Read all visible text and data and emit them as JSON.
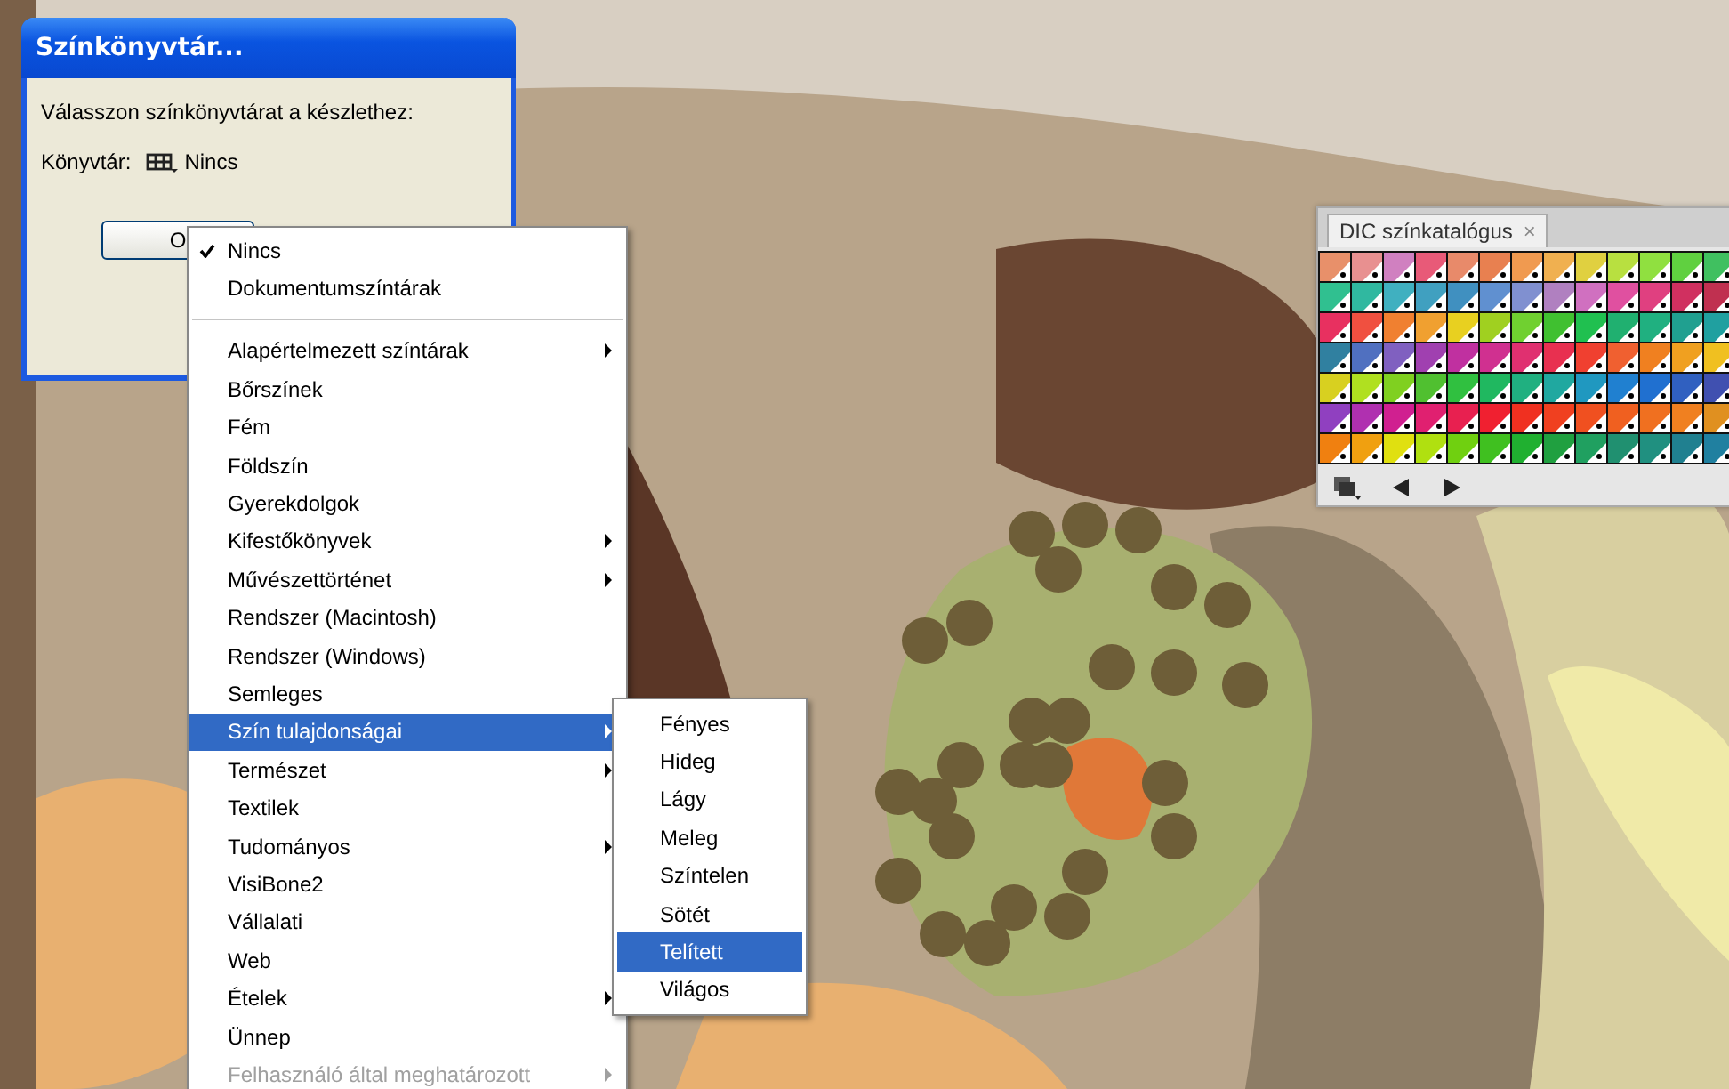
{
  "dialog": {
    "title": "Színkönyvtár...",
    "prompt": "Válasszon színkönyvtárat a készlethez:",
    "library_label": "Könyvtár:",
    "library_value": "Nincs",
    "ok_button": "O"
  },
  "menu": {
    "items": [
      {
        "label": "Nincs",
        "kind": "item",
        "checked": true,
        "submenu": false,
        "selected": false,
        "disabled": false
      },
      {
        "label": "Dokumentumszíntárak",
        "kind": "item",
        "checked": false,
        "submenu": false,
        "selected": false,
        "disabled": false
      },
      {
        "kind": "separator"
      },
      {
        "label": "Alapértelmezett színtárak",
        "kind": "item",
        "checked": false,
        "submenu": true,
        "selected": false,
        "disabled": false
      },
      {
        "label": "Bőrszínek",
        "kind": "item",
        "checked": false,
        "submenu": false,
        "selected": false,
        "disabled": false
      },
      {
        "label": "Fém",
        "kind": "item",
        "checked": false,
        "submenu": false,
        "selected": false,
        "disabled": false
      },
      {
        "label": "Földszín",
        "kind": "item",
        "checked": false,
        "submenu": false,
        "selected": false,
        "disabled": false
      },
      {
        "label": "Gyerekdolgok",
        "kind": "item",
        "checked": false,
        "submenu": false,
        "selected": false,
        "disabled": false
      },
      {
        "label": "Kifestőkönyvek",
        "kind": "item",
        "checked": false,
        "submenu": true,
        "selected": false,
        "disabled": false
      },
      {
        "label": "Művészettörténet",
        "kind": "item",
        "checked": false,
        "submenu": true,
        "selected": false,
        "disabled": false
      },
      {
        "label": "Rendszer (Macintosh)",
        "kind": "item",
        "checked": false,
        "submenu": false,
        "selected": false,
        "disabled": false
      },
      {
        "label": "Rendszer (Windows)",
        "kind": "item",
        "checked": false,
        "submenu": false,
        "selected": false,
        "disabled": false
      },
      {
        "label": "Semleges",
        "kind": "item",
        "checked": false,
        "submenu": false,
        "selected": false,
        "disabled": false
      },
      {
        "label": "Szín tulajdonságai",
        "kind": "item",
        "checked": false,
        "submenu": true,
        "selected": true,
        "disabled": false
      },
      {
        "label": "Természet",
        "kind": "item",
        "checked": false,
        "submenu": true,
        "selected": false,
        "disabled": false
      },
      {
        "label": "Textilek",
        "kind": "item",
        "checked": false,
        "submenu": false,
        "selected": false,
        "disabled": false
      },
      {
        "label": "Tudományos",
        "kind": "item",
        "checked": false,
        "submenu": true,
        "selected": false,
        "disabled": false
      },
      {
        "label": "VisiBone2",
        "kind": "item",
        "checked": false,
        "submenu": false,
        "selected": false,
        "disabled": false
      },
      {
        "label": "Vállalati",
        "kind": "item",
        "checked": false,
        "submenu": false,
        "selected": false,
        "disabled": false
      },
      {
        "label": "Web",
        "kind": "item",
        "checked": false,
        "submenu": false,
        "selected": false,
        "disabled": false
      },
      {
        "label": "Ételek",
        "kind": "item",
        "checked": false,
        "submenu": true,
        "selected": false,
        "disabled": false
      },
      {
        "label": "Ünnep",
        "kind": "item",
        "checked": false,
        "submenu": false,
        "selected": false,
        "disabled": false
      },
      {
        "label": "Felhasználó által meghatározott",
        "kind": "item",
        "checked": false,
        "submenu": true,
        "selected": false,
        "disabled": true
      }
    ]
  },
  "submenu": {
    "items": [
      {
        "label": "Fényes",
        "selected": false
      },
      {
        "label": "Hideg",
        "selected": false
      },
      {
        "label": "Lágy",
        "selected": false
      },
      {
        "label": "Meleg",
        "selected": false
      },
      {
        "label": "Színtelen",
        "selected": false
      },
      {
        "label": "Sötét",
        "selected": false
      },
      {
        "label": "Telített",
        "selected": true
      },
      {
        "label": "Világos",
        "selected": false
      }
    ]
  },
  "swatch_panel": {
    "tab": "DIC színkatalógus",
    "close": "×",
    "swatches": [
      {
        "color": "#e8906a"
      },
      {
        "color": "#e89090"
      },
      {
        "color": "#d080c0"
      },
      {
        "color": "#e85a78"
      },
      {
        "color": "#e88a6a"
      },
      {
        "color": "#e88050"
      },
      {
        "color": "#f09a50"
      },
      {
        "color": "#f0b050"
      },
      {
        "color": "#e0d040"
      },
      {
        "color": "#b8e040"
      },
      {
        "color": "#90e040"
      },
      {
        "color": "#60d040"
      },
      {
        "color": "#40c060"
      },
      {
        "color": "#30c090"
      },
      {
        "color": "#30b8a0"
      },
      {
        "color": "#40b0c0"
      },
      {
        "color": "#40a0c0"
      },
      {
        "color": "#4090c0"
      },
      {
        "color": "#6090d0"
      },
      {
        "color": "#8090d0"
      },
      {
        "color": "#b080c0"
      },
      {
        "color": "#d070c0"
      },
      {
        "color": "#e050a0"
      },
      {
        "color": "#e04080"
      },
      {
        "color": "#d03060"
      },
      {
        "color": "#c03050"
      },
      {
        "color": "#e83060"
      },
      {
        "color": "#f05040"
      },
      {
        "color": "#f08030"
      },
      {
        "color": "#f0a030"
      },
      {
        "color": "#e8d020"
      },
      {
        "color": "#a0d020"
      },
      {
        "color": "#70d030"
      },
      {
        "color": "#40c030"
      },
      {
        "color": "#20c050"
      },
      {
        "color": "#20b070"
      },
      {
        "color": "#20b080"
      },
      {
        "color": "#20a090"
      },
      {
        "color": "#20a0a0"
      },
      {
        "color": "#3080a0"
      },
      {
        "color": "#5070c0"
      },
      {
        "color": "#8060c0"
      },
      {
        "color": "#a040b0"
      },
      {
        "color": "#c030a0"
      },
      {
        "color": "#d03090"
      },
      {
        "color": "#e03070"
      },
      {
        "color": "#e83050"
      },
      {
        "color": "#f04030"
      },
      {
        "color": "#f06030"
      },
      {
        "color": "#f08020"
      },
      {
        "color": "#f0a020"
      },
      {
        "color": "#f0c020"
      },
      {
        "color": "#d8d020"
      },
      {
        "color": "#b0e020"
      },
      {
        "color": "#80d020"
      },
      {
        "color": "#50c030"
      },
      {
        "color": "#30c040"
      },
      {
        "color": "#20b860"
      },
      {
        "color": "#20b080"
      },
      {
        "color": "#20a8a0"
      },
      {
        "color": "#2098c0"
      },
      {
        "color": "#2080d0"
      },
      {
        "color": "#2070d0"
      },
      {
        "color": "#3060c0"
      },
      {
        "color": "#4050b0"
      },
      {
        "color": "#9040c0"
      },
      {
        "color": "#b030b0"
      },
      {
        "color": "#d02090"
      },
      {
        "color": "#e02070"
      },
      {
        "color": "#e82050"
      },
      {
        "color": "#f02030"
      },
      {
        "color": "#f03020"
      },
      {
        "color": "#f04020"
      },
      {
        "color": "#f05020"
      },
      {
        "color": "#f06020"
      },
      {
        "color": "#f07020"
      },
      {
        "color": "#f08020"
      },
      {
        "color": "#e09020"
      },
      {
        "color": "#f08010"
      },
      {
        "color": "#f0a010"
      },
      {
        "color": "#e0e010"
      },
      {
        "color": "#b0e010"
      },
      {
        "color": "#70d010"
      },
      {
        "color": "#40c020"
      },
      {
        "color": "#20b030"
      },
      {
        "color": "#20a040"
      },
      {
        "color": "#20a060"
      },
      {
        "color": "#209070"
      },
      {
        "color": "#209080"
      },
      {
        "color": "#208090"
      },
      {
        "color": "#2080a0"
      }
    ]
  }
}
